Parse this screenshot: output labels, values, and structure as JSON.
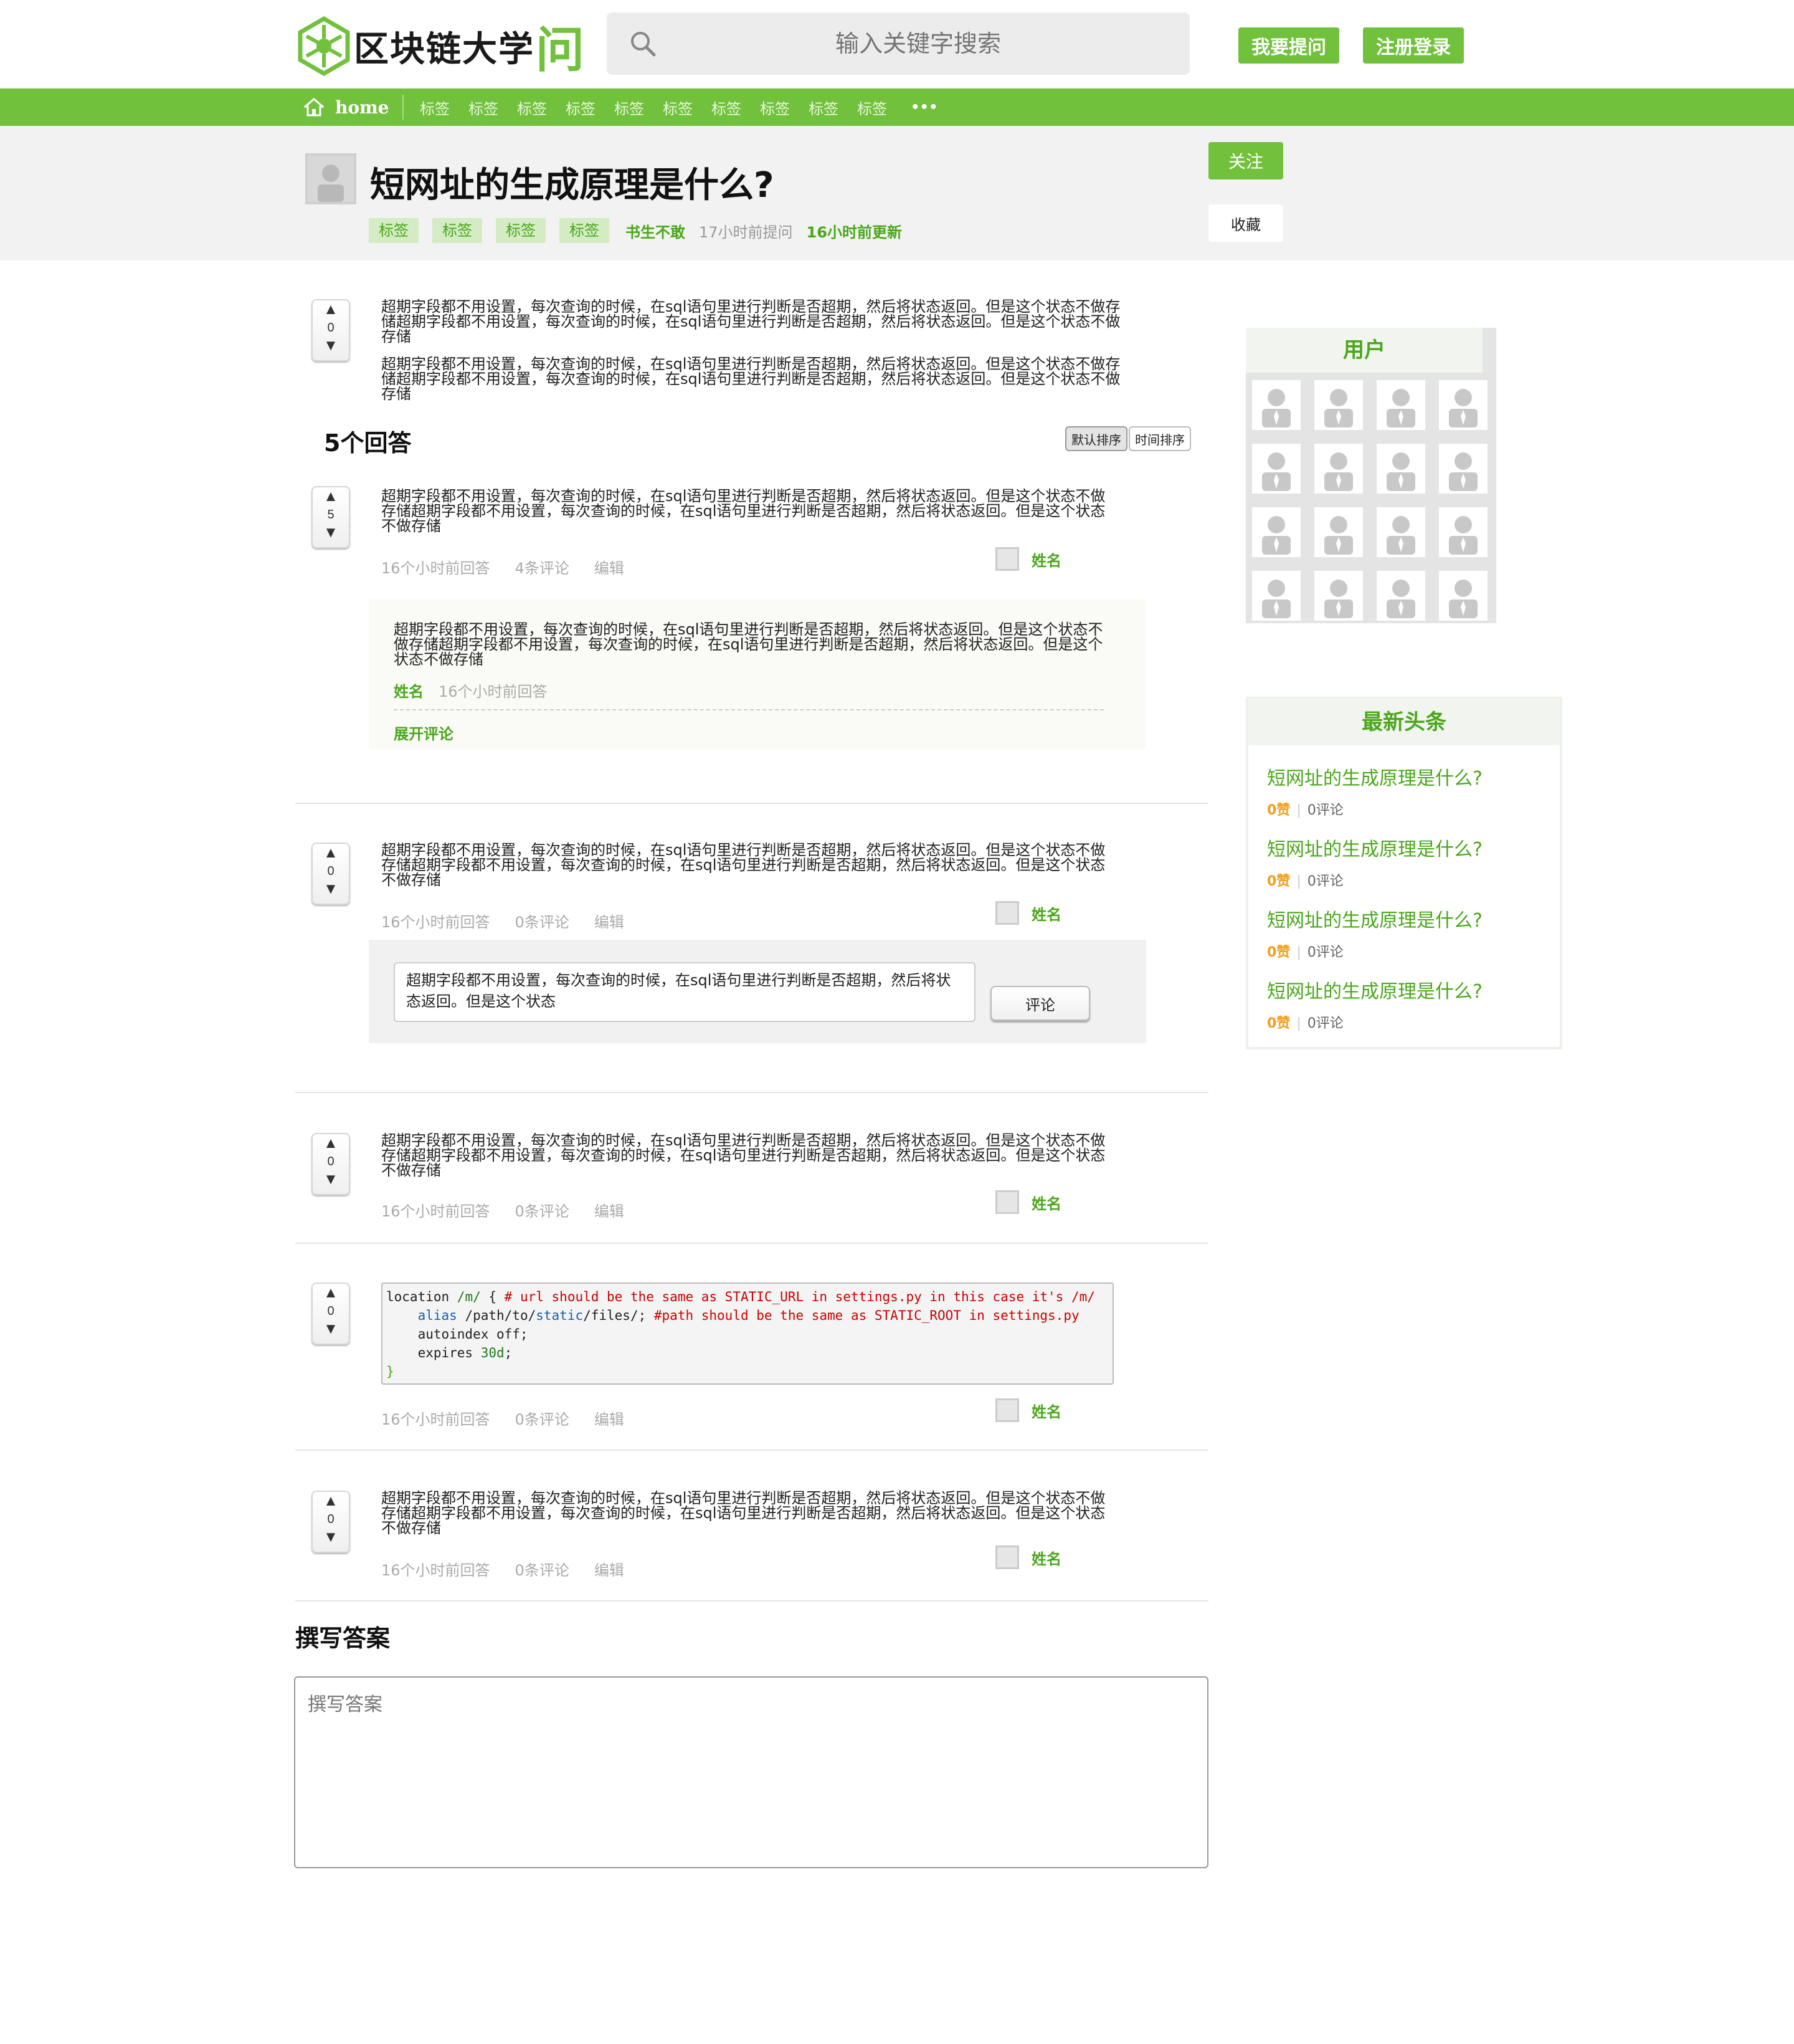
{
  "header": {
    "logo_text": "区块链大学",
    "logo_accent": "问",
    "search_placeholder": "输入关键字搜索",
    "ask_label": "我要提问",
    "login_label": "注册登录"
  },
  "nav": {
    "home_label": "home",
    "tags": [
      "标签",
      "标签",
      "标签",
      "标签",
      "标签",
      "标签",
      "标签",
      "标签",
      "标签",
      "标签"
    ],
    "more_label": "•••"
  },
  "question": {
    "title": "短网址的生成原理是什么?",
    "tags": [
      "标签",
      "标签",
      "标签",
      "标签"
    ],
    "author": "书生不敢",
    "asked": "17小时前提问",
    "updated": "16小时前更新",
    "follow_label": "关注",
    "favorite_label": "收藏",
    "votes": "0",
    "body_1": "超期字段都不用设置，每次查询的时候，在sql语句里进行判断是否超期，然后将状态返回。但是这个状态不做存储超期字段都不用设置，每次查询的时候，在sql语句里进行判断是否超期，然后将状态返回。但是这个状态不做存储",
    "body_2": "超期字段都不用设置，每次查询的时候，在sql语句里进行判断是否超期，然后将状态返回。但是这个状态不做存储超期字段都不用设置，每次查询的时候，在sql语句里进行判断是否超期，然后将状态返回。但是这个状态不做存储"
  },
  "answers_section": {
    "count_title": "5个回答",
    "sort_default": "默认排序",
    "sort_time": "时间排序"
  },
  "answers": [
    {
      "votes": "5",
      "body": "超期字段都不用设置，每次查询的时候，在sql语句里进行判断是否超期，然后将状态返回。但是这个状态不做存储超期字段都不用设置，每次查询的时候，在sql语句里进行判断是否超期，然后将状态返回。但是这个状态不做存储",
      "time": "16个小时前回答",
      "comments": "4条评论",
      "edit": "编辑",
      "user": "姓名"
    },
    {
      "votes": "0",
      "body": "超期字段都不用设置，每次查询的时候，在sql语句里进行判断是否超期，然后将状态返回。但是这个状态不做存储超期字段都不用设置，每次查询的时候，在sql语句里进行判断是否超期，然后将状态返回。但是这个状态不做存储",
      "time": "16个小时前回答",
      "comments": "0条评论",
      "edit": "编辑",
      "user": "姓名"
    },
    {
      "votes": "0",
      "body": "超期字段都不用设置，每次查询的时候，在sql语句里进行判断是否超期，然后将状态返回。但是这个状态不做存储超期字段都不用设置，每次查询的时候，在sql语句里进行判断是否超期，然后将状态返回。但是这个状态不做存储",
      "time": "16个小时前回答",
      "comments": "0条评论",
      "edit": "编辑",
      "user": "姓名"
    },
    {
      "votes": "0",
      "code_line_1_a": "location ",
      "code_line_1_b": "/m/",
      "code_line_1_c": " { ",
      "code_line_1_comment": "# url should be the same as STATIC_URL in settings.py in this case it's /m/",
      "code_line_2_a": "    alias ",
      "code_line_2_b": "/path/to/",
      "code_line_2_c": "static",
      "code_line_2_d": "/files/; ",
      "code_line_2_comment": "#path should be the same as STATIC_ROOT in settings.py",
      "code_line_3": "    autoindex off;",
      "code_line_4_a": "    expires ",
      "code_line_4_b": "30d",
      "code_line_4_c": ";",
      "code_line_5": "}",
      "time": "16个小时前回答",
      "comments": "0条评论",
      "edit": "编辑",
      "user": "姓名"
    },
    {
      "votes": "0",
      "body": "超期字段都不用设置，每次查询的时候，在sql语句里进行判断是否超期，然后将状态返回。但是这个状态不做存储超期字段都不用设置，每次查询的时候，在sql语句里进行判断是否超期，然后将状态返回。但是这个状态不做存储",
      "time": "16个小时前回答",
      "comments": "0条评论",
      "edit": "编辑",
      "user": "姓名"
    }
  ],
  "comment": {
    "body": "超期字段都不用设置，每次查询的时候，在sql语句里进行判断是否超期，然后将状态返回。但是这个状态不做存储超期字段都不用设置，每次查询的时候，在sql语句里进行判断是否超期，然后将状态返回。但是这个状态不做存储",
    "author": "姓名",
    "time": "16个小时前回答",
    "expand_label": "展开评论"
  },
  "reply": {
    "value": "超期字段都不用设置，每次查询的时候，在sql语句里进行判断是否超期，然后将状态返回。但是这个状态",
    "button_label": "评论"
  },
  "write_answer": {
    "title": "撰写答案",
    "placeholder": "撰写答案"
  },
  "sidebar": {
    "users_title": "用户",
    "news_title": "最新头条",
    "news": [
      {
        "title": "短网址的生成原理是什么?",
        "likes": "0赞",
        "comments": "0评论"
      },
      {
        "title": "短网址的生成原理是什么?",
        "likes": "0赞",
        "comments": "0评论"
      },
      {
        "title": "短网址的生成原理是什么?",
        "likes": "0赞",
        "comments": "0评论"
      },
      {
        "title": "短网址的生成原理是什么?",
        "likes": "0赞",
        "comments": "0评论"
      }
    ]
  },
  "colors": {
    "brand_green": "#71c13d",
    "link_green": "#4aa71a",
    "likes_orange": "#f0a020"
  }
}
